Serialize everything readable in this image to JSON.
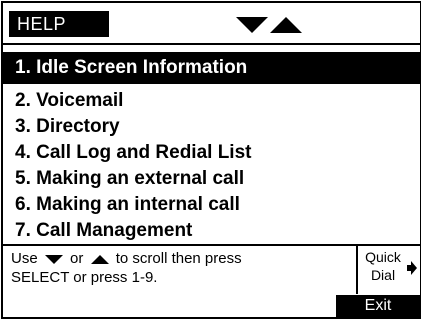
{
  "header": {
    "title": "HELP"
  },
  "menu": {
    "items": [
      {
        "label": "1. Idle Screen Information",
        "selected": true
      },
      {
        "label": "2. Voicemail",
        "selected": false
      },
      {
        "label": "3. Directory",
        "selected": false
      },
      {
        "label": "4. Call Log and Redial List",
        "selected": false
      },
      {
        "label": "5. Making an external call",
        "selected": false
      },
      {
        "label": "6. Making an internal call",
        "selected": false
      },
      {
        "label": "7. Call Management",
        "selected": false
      }
    ]
  },
  "footer": {
    "help_use": "Use",
    "help_or": "or",
    "help_scroll": "to scroll then press",
    "help_line2": "SELECT or press 1-9.",
    "quick_dial_line1": "Quick",
    "quick_dial_line2": "Dial",
    "exit_label": "Exit"
  },
  "icons": {
    "scroll_down": "triangle-down-icon",
    "scroll_up": "triangle-up-icon",
    "quick_dial_arrow": "arrow-right-icon"
  },
  "colors": {
    "foreground": "#000000",
    "background": "#ffffff"
  }
}
